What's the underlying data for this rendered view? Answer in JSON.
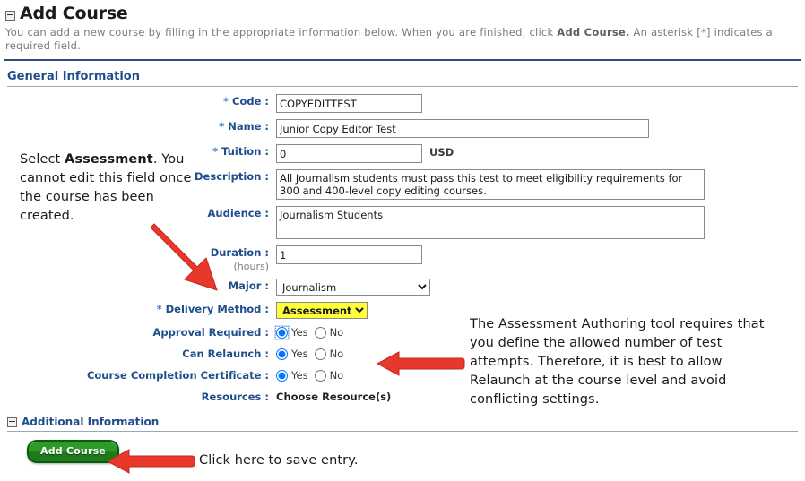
{
  "header": {
    "collapse_icon": "minus-box-icon",
    "title": "Add Course",
    "description_part1": "You can add a new course by filling in the appropriate information below. When you are finished, click ",
    "description_bold": "Add Course.",
    "description_part2": " An asterisk [*] indicates a required field."
  },
  "sections": {
    "general": {
      "title": "General Information"
    },
    "additional": {
      "title": "Additional Information",
      "collapse_icon": "minus-box-icon"
    }
  },
  "form": {
    "code": {
      "label": "Code :",
      "required_mark": "*",
      "value": "COPYEDITTEST"
    },
    "name": {
      "label": "Name :",
      "required_mark": "*",
      "value": "Junior Copy Editor Test"
    },
    "tuition": {
      "label": "Tuition :",
      "required_mark": "*",
      "value": "0",
      "unit": "USD"
    },
    "description": {
      "label": "Description :",
      "value": "All Journalism students must pass this test to meet eligibility requirements for 300 and 400-level copy editing courses."
    },
    "audience": {
      "label": "Audience :",
      "value": "Journalism Students"
    },
    "duration": {
      "label": "Duration :",
      "sublabel": "(hours)",
      "value": "1"
    },
    "major": {
      "label": "Major :",
      "value": "Journalism",
      "options": [
        "Journalism"
      ]
    },
    "delivery": {
      "label": "Delivery Method :",
      "required_mark": "*",
      "value": "Assessment",
      "options": [
        "Assessment"
      ],
      "highlight_color": "#ffff3b"
    },
    "approval": {
      "label": "Approval Required :",
      "yes": "Yes",
      "no": "No",
      "selected": "Yes"
    },
    "relaunch": {
      "label": "Can Relaunch :",
      "yes": "Yes",
      "no": "No",
      "selected": "Yes"
    },
    "certificate": {
      "label": "Course Completion Certificate :",
      "yes": "Yes",
      "no": "No",
      "selected": "Yes"
    },
    "resources": {
      "label": "Resources :",
      "value": "Choose Resource(s)"
    }
  },
  "actions": {
    "add_course": "Add Course"
  },
  "annotations": {
    "left": {
      "line1_pre": "Select ",
      "line1_bold": "Assessment",
      "line1_post": ".",
      "rest": "You cannot edit this field once the course has been created."
    },
    "right": "The Assessment Authoring tool requires that you define the allowed number of test attempts. Therefore, it is best to allow Relaunch at the course level and avoid conflicting settings.",
    "bottom": "Click here to save entry.",
    "arrow_color": "#e8372b"
  }
}
